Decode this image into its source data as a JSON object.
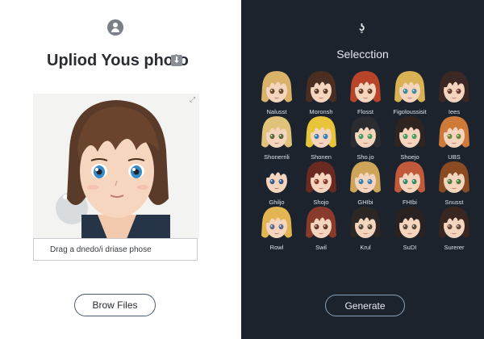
{
  "upload": {
    "title": "Upliod Yous photo",
    "drop_placeholder": "Drag a dnedo/i driase phose",
    "browse_label": "Brow Files"
  },
  "selection": {
    "title": "Selecction",
    "generate_label": "Generate",
    "styles": [
      {
        "label": "Nalusst",
        "hair": "#d9b36a",
        "eyes": "#6a4a2a"
      },
      {
        "label": "Moronsh",
        "hair": "#4a2e22",
        "eyes": "#5a3a26"
      },
      {
        "label": "Flosst",
        "hair": "#b8452a",
        "eyes": "#6a3a22"
      },
      {
        "label": "Figoloussisit",
        "hair": "#d8b255",
        "eyes": "#3f8a9a"
      },
      {
        "label": "Iees",
        "hair": "#3b2824",
        "eyes": "#6a3a2a"
      },
      {
        "label": "Shonerrili",
        "hair": "#e0c27a",
        "eyes": "#5a6a3a"
      },
      {
        "label": "Shonen",
        "hair": "#e8c43a",
        "eyes": "#3a7fb0"
      },
      {
        "label": "Sho.jo",
        "hair": "#2a2c30",
        "eyes": "#4a9a60"
      },
      {
        "label": "Shoejo",
        "hair": "#2f2420",
        "eyes": "#4a9a60"
      },
      {
        "label": "UBS",
        "hair": "#d07a3a",
        "eyes": "#6a8a3a"
      },
      {
        "label": "Ghiljo",
        "hair": "#1c2430",
        "eyes": "#3a5a8a"
      },
      {
        "label": "Shojo",
        "hair": "#6a2a22",
        "eyes": "#8a3a2a"
      },
      {
        "label": "GHIbi",
        "hair": "#cfa55a",
        "eyes": "#3a7fb0"
      },
      {
        "label": "FHIbi",
        "hair": "#c05a3a",
        "eyes": "#3a8a6a"
      },
      {
        "label": "Snusst",
        "hair": "#8a4a22",
        "eyes": "#4a7a3a"
      },
      {
        "label": "Rowl",
        "hair": "#e2b550",
        "eyes": "#5a6a8a"
      },
      {
        "label": "Swil",
        "hair": "#8a3a2a",
        "eyes": "#6a3a2a"
      },
      {
        "label": "Krul",
        "hair": "#2c2624",
        "eyes": "#5a4a3a"
      },
      {
        "label": "SuDI",
        "hair": "#2a2220",
        "eyes": "#5a4a3a"
      },
      {
        "label": "Surerer",
        "hair": "#3a2620",
        "eyes": "#6a4a3a"
      }
    ]
  },
  "colors": {
    "dark_bg": "#1c232d",
    "light_bg": "#ffffff",
    "button_border_light": "#4b5a70",
    "button_border_dark": "#8aa0b8"
  },
  "icons": {
    "user": "user-circle-icon",
    "download": "download-icon",
    "expand": "expand-icon",
    "logo": "logo-icon"
  }
}
